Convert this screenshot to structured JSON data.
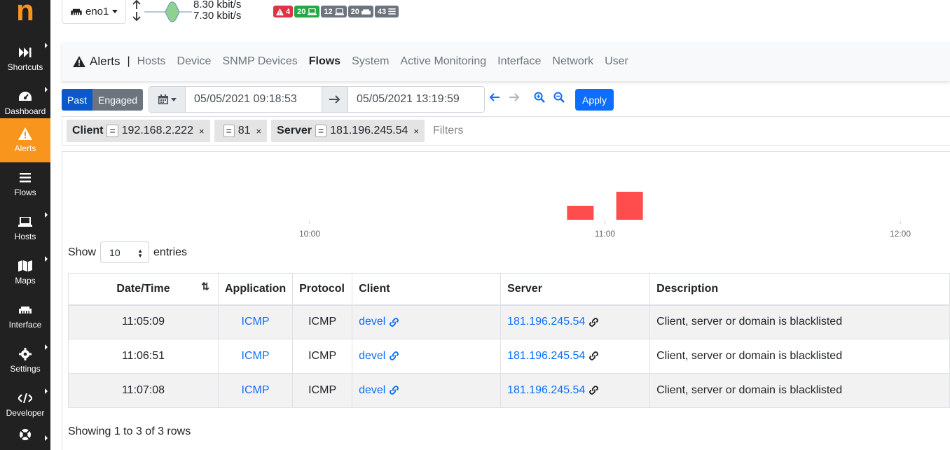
{
  "logo": "n",
  "sidebar": {
    "items": [
      {
        "label": "Shortcuts",
        "icon": "fast-forward-icon",
        "caret": true,
        "active": false
      },
      {
        "label": "Dashboard",
        "icon": "gauge-icon",
        "caret": true,
        "active": false
      },
      {
        "label": "Alerts",
        "icon": "warning-icon",
        "caret": false,
        "active": true
      },
      {
        "label": "Flows",
        "icon": "bars-icon",
        "caret": false,
        "active": false
      },
      {
        "label": "Hosts",
        "icon": "laptop-icon",
        "caret": true,
        "active": false
      },
      {
        "label": "Maps",
        "icon": "map-icon",
        "caret": true,
        "active": false
      },
      {
        "label": "Interface",
        "icon": "ethernet-icon",
        "caret": false,
        "active": false
      },
      {
        "label": "Settings",
        "icon": "gear-icon",
        "caret": true,
        "active": false
      },
      {
        "label": "Developer",
        "icon": "code-icon",
        "caret": true,
        "active": false
      },
      {
        "label": "",
        "icon": "lifebuoy-icon",
        "caret": true,
        "active": false
      }
    ]
  },
  "topbar": {
    "interface": "eno1",
    "rate_up": "8.30 kbit/s",
    "rate_down": "7.30 kbit/s",
    "badges": [
      {
        "value": "4",
        "icon": "warning-icon",
        "color": "#dc3545"
      },
      {
        "value": "20",
        "icon": "laptop-icon",
        "color": "#28a745"
      },
      {
        "value": "12",
        "icon": "laptop-icon",
        "color": "#6c757d"
      },
      {
        "value": "20",
        "icon": "ethernet-icon",
        "color": "#6c757d"
      },
      {
        "value": "43",
        "icon": "bars-icon",
        "color": "#6c757d"
      }
    ]
  },
  "tabs": {
    "title": "Alerts",
    "items": [
      "Hosts",
      "Device",
      "SNMP Devices",
      "Flows",
      "System",
      "Active Monitoring",
      "Interface",
      "Network",
      "User"
    ],
    "active": "Flows"
  },
  "toolbar": {
    "past": "Past",
    "engaged": "Engaged",
    "from": "05/05/2021 09:18:53",
    "to": "05/05/2021 13:19:59",
    "apply": "Apply"
  },
  "filters": {
    "chips": [
      {
        "key": "Client",
        "op": "=",
        "value": "192.168.2.222"
      },
      {
        "key": "",
        "op": "=",
        "value": "81"
      },
      {
        "key": "Server",
        "op": "=",
        "value": "181.196.245.54"
      }
    ],
    "placeholder": "Filters",
    "remove": "×"
  },
  "chart_data": {
    "type": "bar",
    "x_ticks": [
      "10:00",
      "11:00",
      "12:00"
    ],
    "series": [
      {
        "values": [
          {
            "x": "10:55",
            "y": 1
          },
          {
            "x": "11:05",
            "y": 2
          }
        ]
      }
    ],
    "color": "#ff4c4c"
  },
  "table": {
    "show_label": "Show",
    "page_size": "10",
    "entries_label": "entries",
    "columns": [
      "Date/Time",
      "Application",
      "Protocol",
      "Client",
      "Server",
      "Description"
    ],
    "rows": [
      {
        "time": "11:05:09",
        "app": "ICMP",
        "proto": "ICMP",
        "client": "devel",
        "server": "181.196.245.54",
        "desc": "Client, server or domain is blacklisted"
      },
      {
        "time": "11:06:51",
        "app": "ICMP",
        "proto": "ICMP",
        "client": "devel",
        "server": "181.196.245.54",
        "desc": "Client, server or domain is blacklisted"
      },
      {
        "time": "11:07:08",
        "app": "ICMP",
        "proto": "ICMP",
        "client": "devel",
        "server": "181.196.245.54",
        "desc": "Client, server or domain is blacklisted"
      }
    ],
    "footer": "Showing 1 to 3 of 3 rows"
  }
}
